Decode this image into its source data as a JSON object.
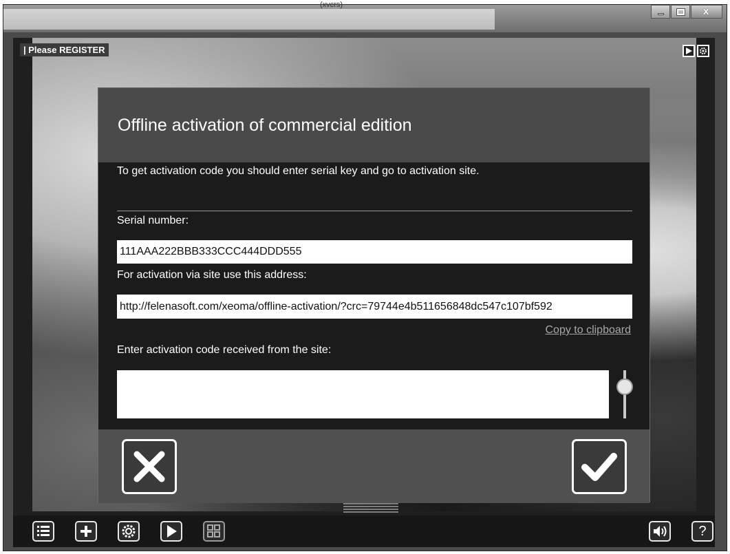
{
  "window": {
    "title": "(xvcrs)",
    "controls": [
      "minimize-icon",
      "maximize-icon",
      "close-icon"
    ],
    "close_glyph": "x"
  },
  "overlay": {
    "register_label": "| Please REGISTER",
    "top_icons": [
      "play-icon",
      "settings-icon"
    ]
  },
  "dialog": {
    "title": "Offline activation of commercial edition",
    "intro": "To get activation code you should enter serial key and go to activation site.",
    "serial_label": "Serial number:",
    "serial_value": "111AAA222BBB333CCC444DDD555",
    "address_label": "For activation via site use this address:",
    "address_value": "http://felenasoft.com/xeoma/offline-activation/?crc=79744e4b511656848dc547c107bf592",
    "copy_link": "Copy to clipboard",
    "code_label": "Enter activation code received from the site:",
    "code_value": "",
    "buttons": {
      "cancel_icon": "close-x-icon",
      "ok_icon": "checkmark-icon"
    }
  },
  "toolbar": {
    "left": [
      "list-icon",
      "add-icon",
      "settings-gear-icon",
      "play-icon",
      "layout-grid-icon"
    ],
    "right": [
      "sound-icon",
      "help-icon"
    ],
    "help_glyph": "?"
  },
  "colors": {
    "dialog_bg": "#3e3e3e",
    "dialog_body_bg": "#1b1b1b",
    "text": "#ffffff",
    "link": "#a8a8a8"
  }
}
